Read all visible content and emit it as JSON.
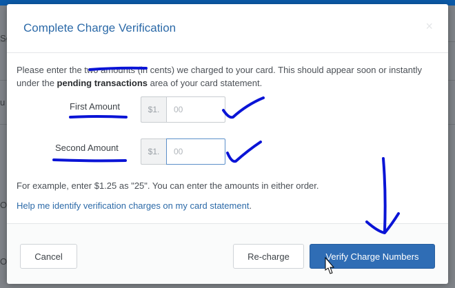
{
  "background": {
    "fragments": [
      "Se",
      "u",
      "O",
      "O"
    ]
  },
  "modal": {
    "title": "Complete Charge Verification",
    "close_glyph": "×"
  },
  "intro": {
    "part1": "Please enter the ",
    "underlined": "two amounts",
    "part2": " (in cents) we charged to your card. This should appear soon or instantly under the ",
    "bold": "pending transactions",
    "part3": " area of your card statement."
  },
  "fields": {
    "first": {
      "label": "First Amount",
      "prefix": "$1.",
      "placeholder": "00"
    },
    "second": {
      "label": "Second Amount",
      "prefix": "$1.",
      "placeholder": "00"
    }
  },
  "example_text": "For example, enter $1.25 as \"25\". You can enter the amounts in either order.",
  "help_link": {
    "label": "Help me identify verification charges on my card statement",
    "trailing": "."
  },
  "buttons": {
    "cancel": "Cancel",
    "recharge": "Re-charge",
    "verify": "Verify Charge Numbers"
  },
  "colors": {
    "accent": "#2f6db5",
    "title": "#2c6aa8",
    "annotation_ink": "#0a14d6"
  }
}
